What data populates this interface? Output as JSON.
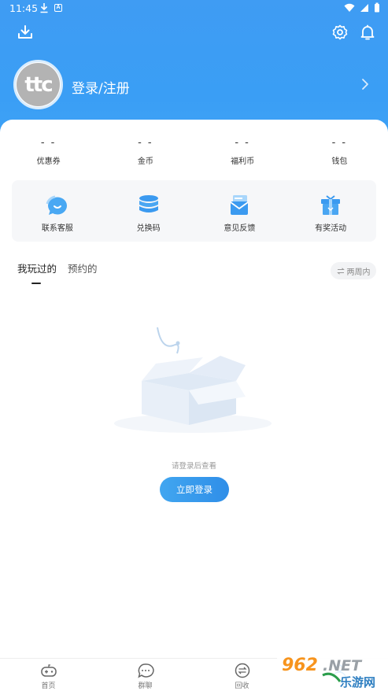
{
  "status_bar": {
    "time": "11:45",
    "a_badge": "A"
  },
  "header": {
    "login_label": "登录/注册",
    "avatar_text": "ttc"
  },
  "stats": [
    {
      "value": "- -",
      "label": "优惠券"
    },
    {
      "value": "- -",
      "label": "金币"
    },
    {
      "value": "- -",
      "label": "福利币"
    },
    {
      "value": "- -",
      "label": "钱包"
    }
  ],
  "tools": [
    {
      "label": "联系客服",
      "icon": "chat-bubble-icon"
    },
    {
      "label": "兑换码",
      "icon": "database-stack-icon"
    },
    {
      "label": "意见反馈",
      "icon": "mail-icon"
    },
    {
      "label": "有奖活动",
      "icon": "gift-icon"
    }
  ],
  "tabs": [
    {
      "label": "我玩过的",
      "active": true
    },
    {
      "label": "预约的",
      "active": false
    }
  ],
  "filter": {
    "label": "两周内",
    "icon": "swap-icon"
  },
  "empty_state": {
    "text": "请登录后查看",
    "button": "立即登录",
    "illustration": "empty-box-illustration"
  },
  "bottom_nav": [
    {
      "label": "首页",
      "icon": "gamepad-icon"
    },
    {
      "label": "群聊",
      "icon": "message-icon"
    },
    {
      "label": "回收",
      "icon": "exchange-icon"
    },
    {
      "label": "",
      "icon": "user-icon"
    }
  ],
  "watermark": {
    "text": "962.NET",
    "subtext": "乐游网"
  },
  "colors": {
    "primary": "#3a9ef5",
    "button": "#2f8ee8",
    "tool_bg": "#f6f7f9"
  }
}
